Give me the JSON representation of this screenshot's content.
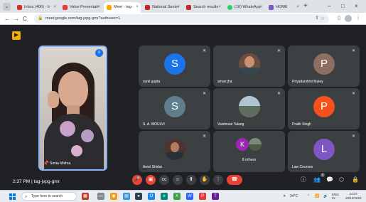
{
  "browser": {
    "tabs": [
      {
        "label": "Inbox (406) - b",
        "favicon_color": "#d93025"
      },
      {
        "label": "Value Presentati",
        "favicon_color": "#e53935"
      },
      {
        "label": "Meet - tag-",
        "favicon_color": "#f9ab00",
        "active": true
      },
      {
        "label": "National Semin",
        "favicon_color": "#c62828"
      },
      {
        "label": "Search results",
        "favicon_color": "#c62828"
      },
      {
        "label": "(18) WhatsApp",
        "favicon_color": "#25d366"
      },
      {
        "label": "HOME",
        "favicon_color": "#7e57c2"
      }
    ],
    "new_tab_icon": "+",
    "window_controls": [
      "–",
      "□",
      "×"
    ],
    "nav": {
      "back": "←",
      "forward": "→",
      "reload": "C"
    },
    "url": "meet.google.com/tag-jvpg-gmr?authuser=1",
    "icons": [
      "share-icon",
      "star-icon",
      "extension-icon",
      "profile-icon",
      "menu-icon"
    ]
  },
  "meet": {
    "self": {
      "name": "Sonia Mishra"
    },
    "participants": [
      {
        "name": "sunil gupta",
        "initial": "S",
        "color": "#1a73e8",
        "type": "initial"
      },
      {
        "name": "aman jha",
        "type": "photo"
      },
      {
        "name": "Priyadarshini Muley",
        "initial": "P",
        "color": "#8d6e63",
        "type": "initial"
      },
      {
        "name": "S. A. MOULVI",
        "initial": "S",
        "color": "#607d8b",
        "type": "initial"
      },
      {
        "name": "Vaishnavi Talang",
        "type": "photo"
      },
      {
        "name": "Pratik Singh",
        "initial": "P",
        "color": "#f4511e",
        "type": "initial"
      },
      {
        "name": "Amol Shidar",
        "type": "photo"
      },
      {
        "name": "",
        "type": "others",
        "others_label": "8 others",
        "initial": "K",
        "color": "#9c27b0"
      },
      {
        "name": "Law Courses",
        "initial": "L",
        "color": "#7e57c2",
        "type": "initial"
      }
    ],
    "meeting_info": "2:37 PM  |  tag-jvpg-gmr",
    "controls": {
      "mic": "mic-off-icon",
      "camera": "camera-off-icon",
      "captions": "captions-icon",
      "emoji": "emoji-icon",
      "present": "present-icon",
      "hand": "raise-hand-icon",
      "more": "more-icon",
      "end": "end-call-icon"
    },
    "right_badge": "9"
  },
  "taskbar": {
    "search_placeholder": "Type here to search",
    "weather": "34°C",
    "lang": "ENG\nIN",
    "time": "14:37",
    "date": "28/12/2023"
  }
}
